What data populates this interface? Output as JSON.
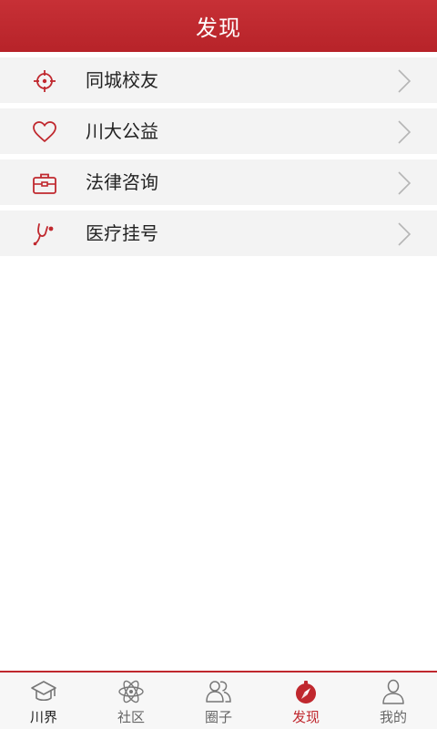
{
  "header": {
    "title": "发现"
  },
  "list": [
    {
      "label": "同城校友",
      "icon": "location-target-icon"
    },
    {
      "label": "川大公益",
      "icon": "heart-icon"
    },
    {
      "label": "法律咨询",
      "icon": "briefcase-icon"
    },
    {
      "label": "医疗挂号",
      "icon": "stethoscope-icon"
    }
  ],
  "tabs": [
    {
      "label": "川界",
      "icon": "graduation-cap-icon"
    },
    {
      "label": "社区",
      "icon": "atom-icon"
    },
    {
      "label": "圈子",
      "icon": "users-icon"
    },
    {
      "label": "发现",
      "icon": "compass-icon",
      "active": true
    },
    {
      "label": "我的",
      "icon": "person-icon"
    }
  ],
  "colors": {
    "accent": "#c0282e",
    "header_bg": "#bf2a30",
    "row_bg": "#f3f3f3",
    "tab_inactive": "#666666"
  }
}
